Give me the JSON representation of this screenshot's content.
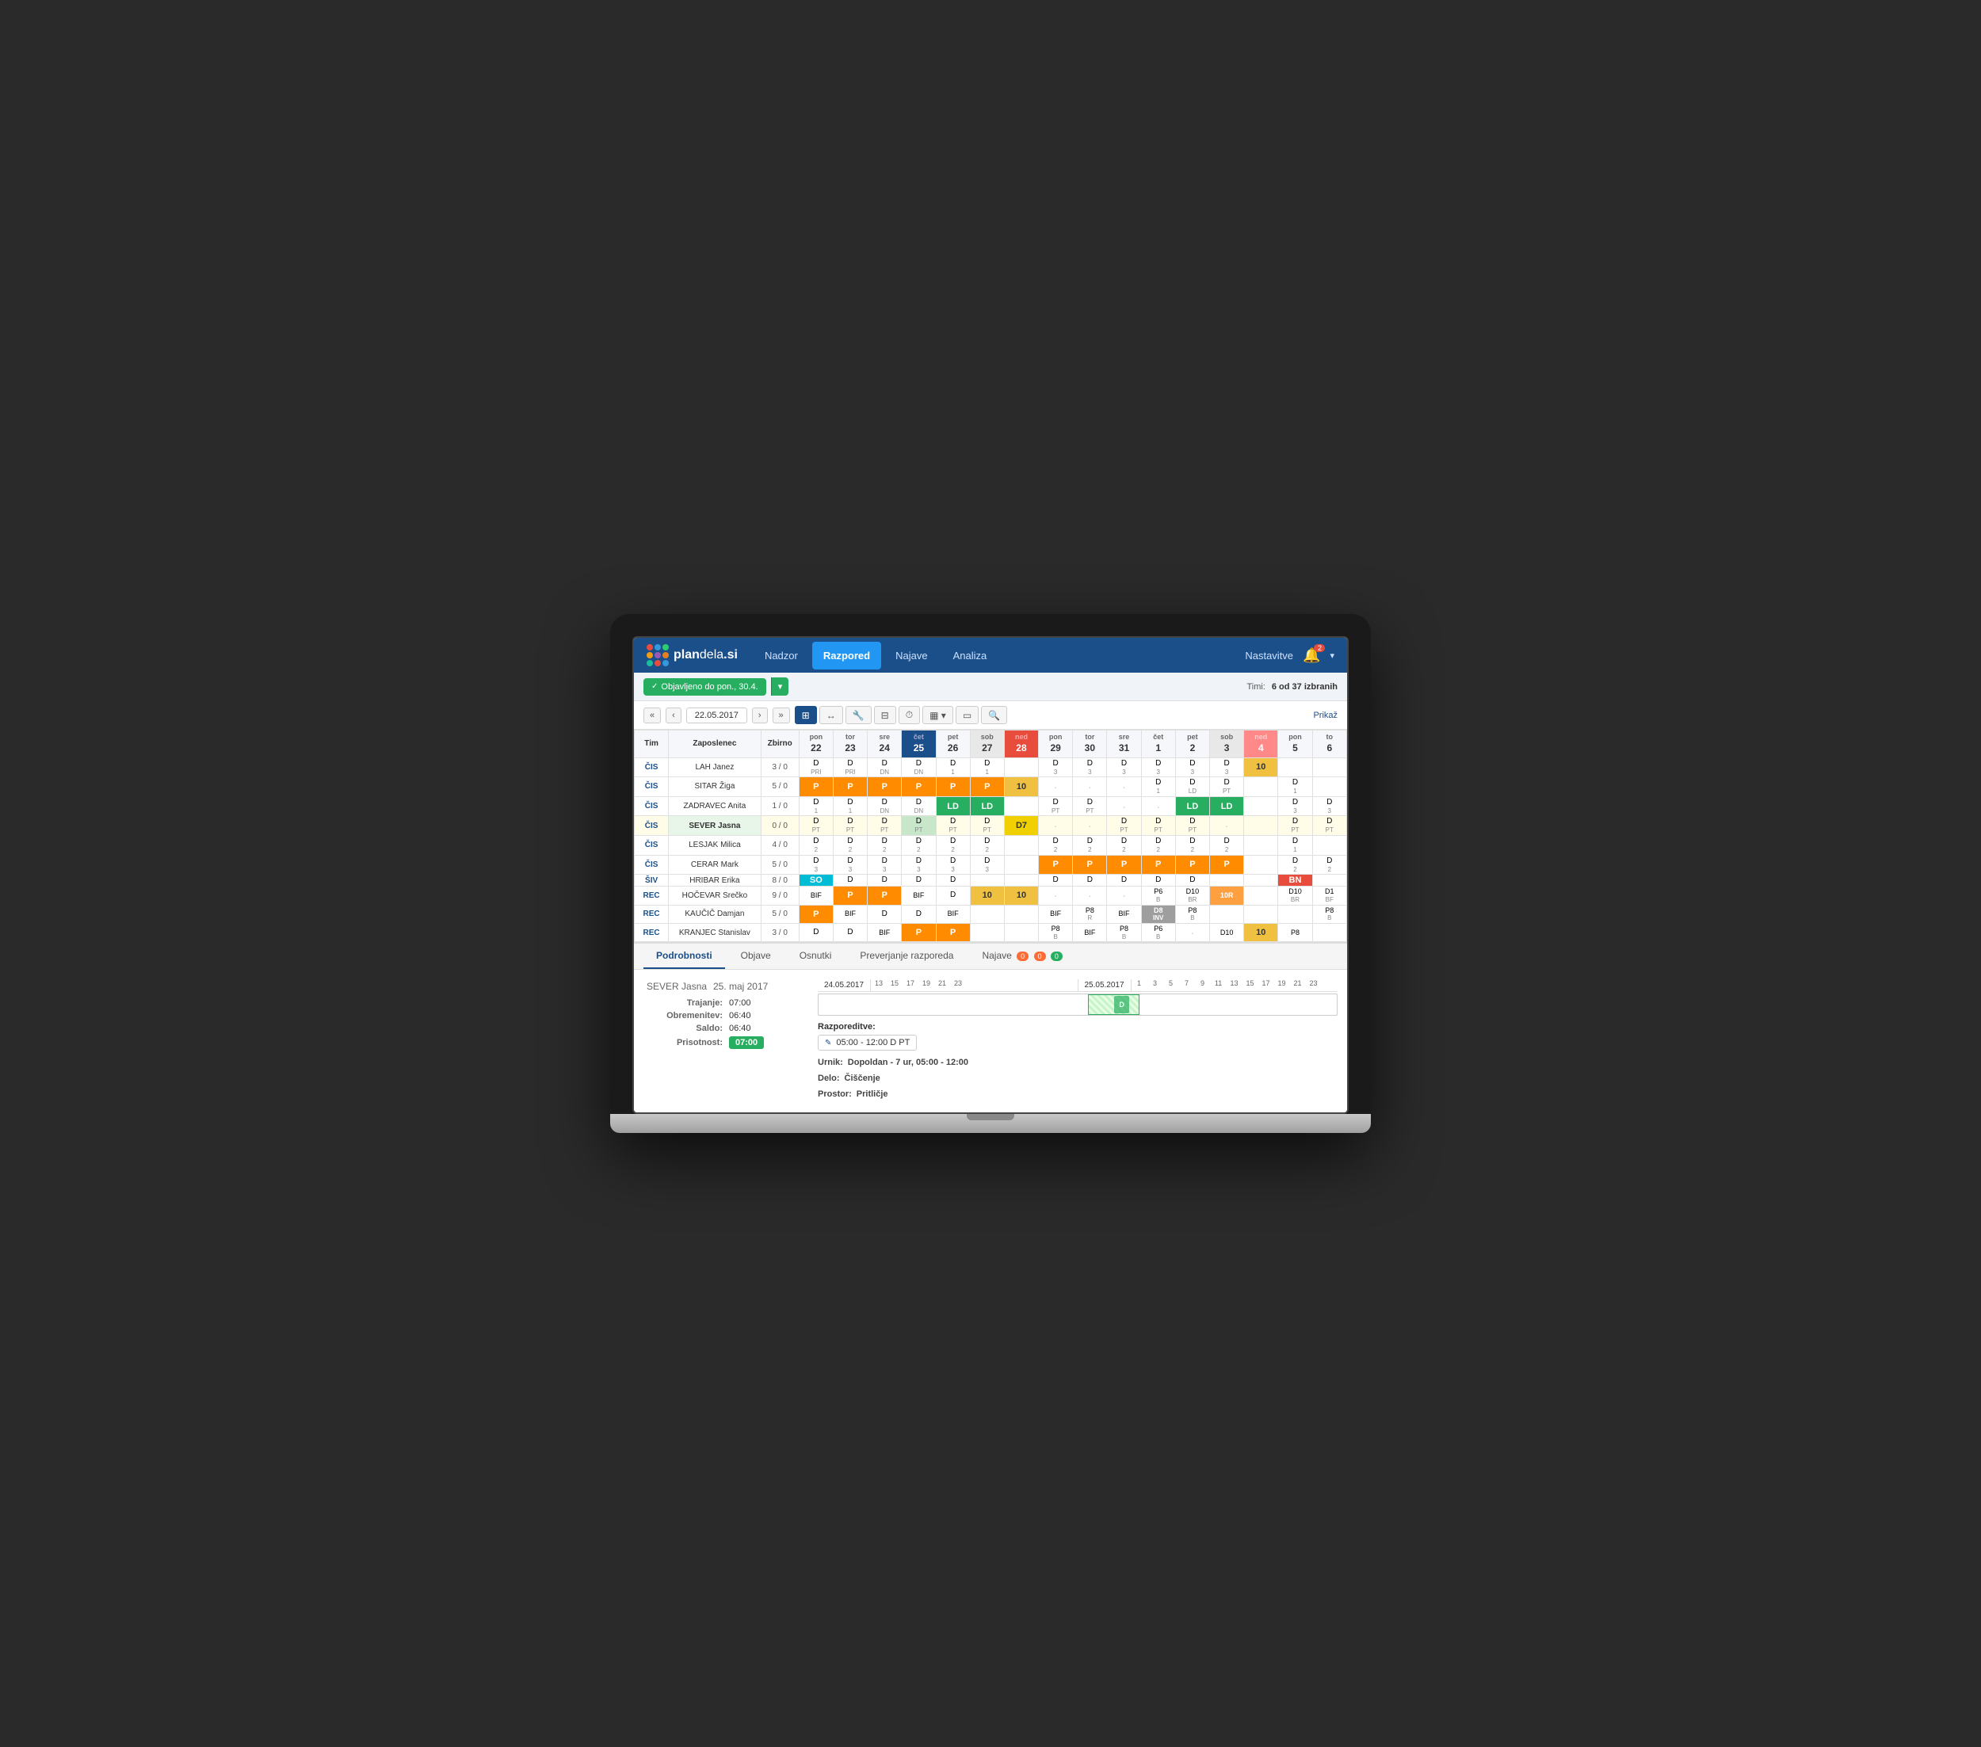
{
  "nav": {
    "logo_text_plan": "plan",
    "logo_text_dela": "dela",
    "logo_domain": ".si",
    "menu_items": [
      "Nadzor",
      "Razpored",
      "Najave",
      "Analiza"
    ],
    "active_menu": "Razpored",
    "settings_label": "Nastavitve",
    "bell_badge": "2"
  },
  "toolbar": {
    "publish_label": "Objavljeno do pon., 30.4.",
    "timi_label": "Timi:",
    "timi_value": "6 od 37 izbranih",
    "prikaz_label": "Prikaž"
  },
  "date_nav": {
    "date_label": "22.05.2017",
    "prev_prev": "«",
    "prev": "‹",
    "next": "›",
    "next_next": "»"
  },
  "schedule": {
    "headers": {
      "tim": "Tim",
      "zaposlenec": "Zaposlenec",
      "zbirno": "Zbirno",
      "days": [
        {
          "name": "pon",
          "num": "22"
        },
        {
          "name": "tor",
          "num": "23"
        },
        {
          "name": "sre",
          "num": "24"
        },
        {
          "name": "čet",
          "num": "25",
          "today": true
        },
        {
          "name": "pet",
          "num": "26"
        },
        {
          "name": "sob",
          "num": "27",
          "weekend": true
        },
        {
          "name": "ned",
          "num": "28",
          "sunday": true
        },
        {
          "name": "pon",
          "num": "29"
        },
        {
          "name": "tor",
          "num": "30"
        },
        {
          "name": "sre",
          "num": "31"
        },
        {
          "name": "čet",
          "num": "1"
        },
        {
          "name": "pet",
          "num": "2"
        },
        {
          "name": "sob",
          "num": "3",
          "weekend": true
        },
        {
          "name": "ned",
          "num": "4",
          "sunday": true
        },
        {
          "name": "pon",
          "num": "5"
        },
        {
          "name": "to",
          "num": "6"
        }
      ]
    },
    "rows": [
      {
        "tim": "ČIS",
        "emp": "LAH Janez",
        "zbirno": "3 / 0",
        "cells": [
          {
            "top": "D",
            "sub": "PRI"
          },
          {
            "top": "D",
            "sub": "PRI"
          },
          {
            "top": "D",
            "sub": "DN"
          },
          {
            "top": "D",
            "sub": "DN"
          },
          {
            "top": "D",
            "sub": "1"
          },
          {
            "top": "D",
            "sub": "1"
          },
          {
            "type": "empty"
          },
          {
            "top": "D",
            "sub": "3"
          },
          {
            "top": "D",
            "sub": "3"
          },
          {
            "top": "D",
            "sub": "3"
          },
          {
            "top": "D",
            "sub": "3"
          },
          {
            "top": "D",
            "sub": "3"
          },
          {
            "top": "D",
            "sub": "3"
          },
          {
            "type": "number",
            "val": "10"
          },
          {
            "type": "empty"
          },
          {
            "type": "empty"
          }
        ]
      },
      {
        "tim": "ČIS",
        "emp": "SITAR Žiga",
        "zbirno": "5 / 0",
        "cells": [
          {
            "type": "orange",
            "val": "P"
          },
          {
            "type": "orange",
            "val": "P"
          },
          {
            "type": "orange",
            "val": "P"
          },
          {
            "type": "orange",
            "val": "P"
          },
          {
            "type": "orange",
            "val": "P"
          },
          {
            "type": "orange",
            "val": "P"
          },
          {
            "type": "number",
            "val": "10"
          },
          {
            "type": "dot"
          },
          {
            "type": "dot"
          },
          {
            "type": "dot"
          },
          {
            "top": "D",
            "sub": "1"
          },
          {
            "top": "D",
            "sub": "LD",
            "sub2": ""
          },
          {
            "top": "D",
            "sub": "PT"
          },
          {
            "type": "empty"
          },
          {
            "top": "D",
            "sub": "1"
          },
          {
            "type": "empty"
          }
        ]
      },
      {
        "tim": "ČIS",
        "emp": "ZADRAVEC Anita",
        "zbirno": "1 / 0",
        "cells": [
          {
            "top": "D",
            "sub": "1"
          },
          {
            "top": "D",
            "sub": "1"
          },
          {
            "top": "D",
            "sub": "DN"
          },
          {
            "top": "D",
            "sub": "DN"
          },
          {
            "type": "green",
            "val": "LD"
          },
          {
            "type": "green",
            "val": "LD"
          },
          {
            "type": "empty"
          },
          {
            "top": "D",
            "sub": "PT"
          },
          {
            "top": "D",
            "sub": "PT"
          },
          {
            "type": "dot"
          },
          {
            "type": "dot"
          },
          {
            "type": "green",
            "val": "LD"
          },
          {
            "type": "green",
            "val": "LD"
          },
          {
            "type": "empty"
          },
          {
            "top": "D",
            "sub": "3"
          },
          {
            "top": "D",
            "sub": "3"
          }
        ]
      },
      {
        "tim": "ČIS",
        "emp": "SEVER Jasna",
        "zbirno": "0 / 0",
        "highlight": true,
        "cells": [
          {
            "top": "D",
            "sub": "PT"
          },
          {
            "top": "D",
            "sub": "PT"
          },
          {
            "top": "D",
            "sub": "PT"
          },
          {
            "top": "D",
            "sub": "PT"
          },
          {
            "top": "D",
            "sub": "PT"
          },
          {
            "top": "D",
            "sub": "PT"
          },
          {
            "type": "yellow-d7",
            "val": "D7"
          },
          {
            "type": "dot"
          },
          {
            "type": "dot"
          },
          {
            "top": "D",
            "sub": "PT"
          },
          {
            "top": "D",
            "sub": "PT"
          },
          {
            "top": "D",
            "sub": "PT"
          },
          {
            "type": "dot"
          },
          {
            "type": "empty"
          },
          {
            "top": "D",
            "sub": "PT"
          },
          {
            "top": "D",
            "sub": "PT"
          }
        ]
      },
      {
        "tim": "ČIS",
        "emp": "LESJAK Milica",
        "zbirno": "4 / 0",
        "cells": [
          {
            "top": "D",
            "sub": "2"
          },
          {
            "top": "D",
            "sub": "2"
          },
          {
            "top": "D",
            "sub": "2"
          },
          {
            "top": "D",
            "sub": "2"
          },
          {
            "top": "D",
            "sub": "2"
          },
          {
            "top": "D",
            "sub": "2"
          },
          {
            "type": "empty"
          },
          {
            "top": "D",
            "sub": "2"
          },
          {
            "top": "D",
            "sub": "2"
          },
          {
            "top": "D",
            "sub": "2"
          },
          {
            "top": "D",
            "sub": "2"
          },
          {
            "top": "D",
            "sub": "2"
          },
          {
            "top": "D",
            "sub": "2"
          },
          {
            "type": "empty"
          },
          {
            "top": "D",
            "sub": "1"
          },
          {
            "type": "empty"
          }
        ]
      },
      {
        "tim": "ČIS",
        "emp": "CERAR Mark",
        "zbirno": "5 / 0",
        "cells": [
          {
            "top": "D",
            "sub": "3"
          },
          {
            "top": "D",
            "sub": "3"
          },
          {
            "top": "D",
            "sub": "3"
          },
          {
            "top": "D",
            "sub": "3"
          },
          {
            "top": "D",
            "sub": "3"
          },
          {
            "top": "D",
            "sub": "3"
          },
          {
            "type": "empty"
          },
          {
            "type": "orange",
            "val": "P"
          },
          {
            "type": "orange",
            "val": "P"
          },
          {
            "type": "orange",
            "val": "P"
          },
          {
            "type": "orange",
            "val": "P"
          },
          {
            "type": "orange",
            "val": "P"
          },
          {
            "type": "orange",
            "val": "P"
          },
          {
            "type": "empty"
          },
          {
            "top": "D",
            "sub": "2"
          },
          {
            "top": "D",
            "sub": "2"
          }
        ]
      },
      {
        "tim": "ŠIV",
        "emp": "HRIBAR Erika",
        "zbirno": "8 / 0",
        "cells": [
          {
            "type": "cyan",
            "val": "SO"
          },
          {
            "top": "D",
            "sub": ""
          },
          {
            "top": "D",
            "sub": ""
          },
          {
            "top": "D",
            "sub": ""
          },
          {
            "top": "D",
            "sub": ""
          },
          {
            "type": "empty"
          },
          {
            "type": "empty"
          },
          {
            "top": "D",
            "sub": ""
          },
          {
            "top": "D",
            "sub": ""
          },
          {
            "top": "D",
            "sub": ""
          },
          {
            "top": "D",
            "sub": ""
          },
          {
            "top": "D",
            "sub": ""
          },
          {
            "type": "empty"
          },
          {
            "type": "empty"
          },
          {
            "type": "red",
            "val": "BN"
          },
          {
            "type": "empty"
          }
        ]
      },
      {
        "tim": "REC",
        "emp": "HOČEVAR Srečko",
        "zbirno": "9 / 0",
        "cells": [
          {
            "top": "BIF",
            "sub": ""
          },
          {
            "type": "orange",
            "val": "P"
          },
          {
            "type": "orange",
            "val": "P"
          },
          {
            "top": "BIF",
            "sub": ""
          },
          {
            "top": "D",
            "sub": ""
          },
          {
            "type": "number",
            "val": "10"
          },
          {
            "type": "number",
            "val": "10"
          },
          {
            "type": "dot"
          },
          {
            "type": "dot"
          },
          {
            "type": "dot"
          },
          {
            "top": "P6",
            "sub": "B"
          },
          {
            "top": "D10",
            "sub": "BR"
          },
          {
            "type": "orange-num",
            "val": "10R"
          },
          {
            "type": "empty"
          },
          {
            "top": "D10",
            "sub": "BR"
          },
          {
            "top": "D1",
            "sub": "BF"
          }
        ]
      },
      {
        "tim": "REC",
        "emp": "KAUČIČ Damjan",
        "zbirno": "5 / 0",
        "cells": [
          {
            "type": "orange",
            "val": "P"
          },
          {
            "top": "BIF",
            "sub": ""
          },
          {
            "top": "D",
            "sub": ""
          },
          {
            "top": "D",
            "sub": ""
          },
          {
            "top": "BIF",
            "sub": ""
          },
          {
            "type": "empty"
          },
          {
            "type": "empty"
          },
          {
            "top": "BIF",
            "sub": ""
          },
          {
            "top": "P8",
            "sub": "R"
          },
          {
            "top": "BIF",
            "sub": ""
          },
          {
            "top": "D8",
            "sub": "INV"
          },
          {
            "top": "P8",
            "sub": "B"
          },
          {
            "type": "empty"
          },
          {
            "type": "empty"
          },
          {
            "type": "empty"
          },
          {
            "top": "P8",
            "sub": "B"
          }
        ]
      },
      {
        "tim": "REC",
        "emp": "KRANJEC Stanislav",
        "zbirno": "3 / 0",
        "cells": [
          {
            "top": "D",
            "sub": ""
          },
          {
            "top": "D",
            "sub": ""
          },
          {
            "top": "BIF",
            "sub": ""
          },
          {
            "type": "orange",
            "val": "P"
          },
          {
            "type": "orange",
            "val": "P"
          },
          {
            "type": "empty"
          },
          {
            "type": "empty"
          },
          {
            "top": "P8",
            "sub": "B"
          },
          {
            "top": "BIF",
            "sub": ""
          },
          {
            "top": "P8",
            "sub": "B"
          },
          {
            "top": "P6",
            "sub": "B"
          },
          {
            "type": "dot"
          },
          {
            "top": "D10",
            "sub": ""
          },
          {
            "type": "number",
            "val": "10"
          },
          {
            "top": "P8",
            "sub": ""
          },
          {
            "type": "empty"
          }
        ]
      }
    ]
  },
  "bottom": {
    "tabs": [
      "Podrobnosti",
      "Objave",
      "Osnutki",
      "Preverjanje razporeda"
    ],
    "najave_label": "Najave",
    "najave_badges": [
      "0",
      "0",
      "0"
    ],
    "active_tab": "Podrobnosti",
    "person_name": "SEVER Jasna",
    "person_date": "25. maj 2017",
    "trajanje_label": "Trajanje:",
    "trajanje_val": "07:00",
    "obremenitev_label": "Obremenitev:",
    "obremenitev_val": "06:40",
    "saldo_label": "Saldo:",
    "saldo_val": "06:40",
    "prisotnost_label": "Prisotnost:",
    "prisotnost_val": "07:00",
    "timeline_date1": "24.05.2017",
    "timeline_date2": "25.05.2017",
    "timeline_hours": [
      "13",
      "15",
      "17",
      "19",
      "21",
      "23",
      "1",
      "3",
      "5",
      "7",
      "9",
      "11",
      "13",
      "15",
      "17",
      "19",
      "21",
      "23"
    ],
    "razporeditve_label": "Razporeditve:",
    "razporeditve_item": "05:00 - 12:00  D  PT",
    "schedule_urnik_label": "Urnik:",
    "schedule_urnik_val": "Dopoldan - 7 ur, 05:00 - 12:00",
    "schedule_delo_label": "Delo:",
    "schedule_delo_val": "Čiščenje",
    "schedule_prostor_label": "Prostor:",
    "schedule_prostor_val": "Pritličje"
  },
  "logo_colors": [
    "#e74c3c",
    "#3498db",
    "#2ecc71",
    "#f39c12",
    "#9b59b6",
    "#1abc9c",
    "#e67e22",
    "#e74c3c",
    "#3498db"
  ]
}
